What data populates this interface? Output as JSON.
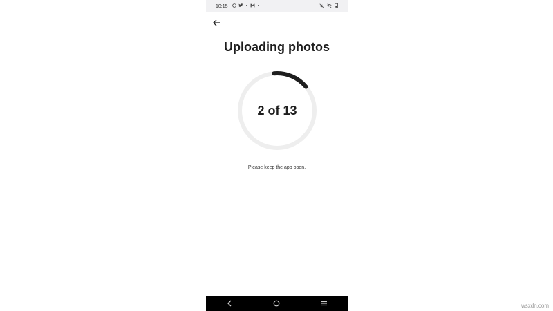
{
  "status_bar": {
    "time": "10:15",
    "left_icons": [
      "whatsapp-icon",
      "twitter-icon",
      "dot-icon",
      "gmail-icon",
      "dot-icon"
    ],
    "right_icons": [
      "mute-icon",
      "wifi-off-icon",
      "battery-icon"
    ]
  },
  "header": {
    "back_icon": "arrow-left-icon"
  },
  "main": {
    "title": "Uploading photos",
    "progress": {
      "label": "2 of 13",
      "current": 2,
      "total": 13
    },
    "hint": "Please keep the app open."
  },
  "nav_bar": {
    "buttons": [
      "back-icon",
      "home-icon",
      "recents-icon"
    ]
  },
  "watermark": "wsxdn.com",
  "colors": {
    "ring_track": "#eeeeee",
    "ring_progress": "#1e1e1e",
    "status_bg": "#f1f1f3",
    "nav_bg": "#000000"
  }
}
